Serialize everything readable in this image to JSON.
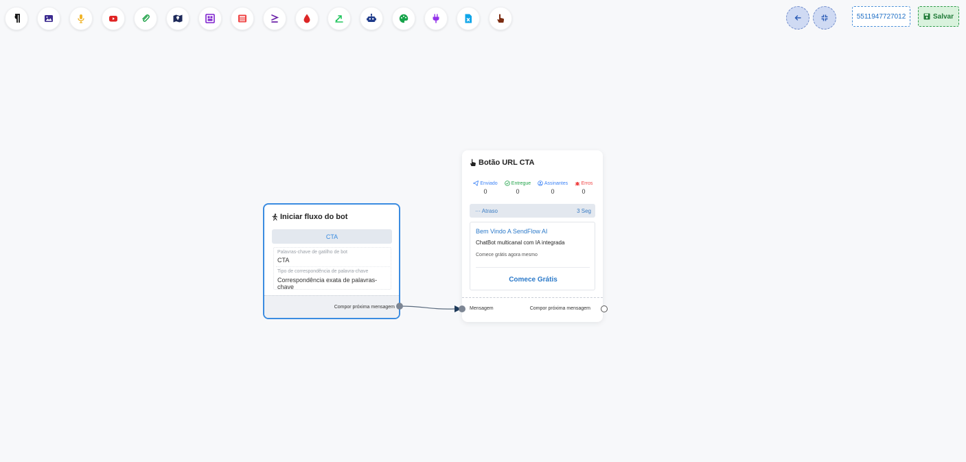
{
  "toolbar": {
    "tools": [
      {
        "name": "paragraph-icon",
        "color": "#111111"
      },
      {
        "name": "image-icon",
        "color": "#3b2a8f"
      },
      {
        "name": "microphone-icon",
        "color": "#f0b429"
      },
      {
        "name": "youtube-icon",
        "color": "#e02424"
      },
      {
        "name": "paperclip-icon",
        "color": "#22a34a"
      },
      {
        "name": "map-icon",
        "color": "#1e2a5a"
      },
      {
        "name": "poll-icon",
        "color": "#7e22ce"
      },
      {
        "name": "newspaper-icon",
        "color": "#ef4444"
      },
      {
        "name": "greater-equal-icon",
        "color": "#6b21a8"
      },
      {
        "name": "drop-icon",
        "color": "#dc2626"
      },
      {
        "name": "webhook-icon",
        "color": "#22c55e"
      },
      {
        "name": "robot-icon",
        "color": "#1e3a8a"
      },
      {
        "name": "palette-icon",
        "color": "#16a34a"
      },
      {
        "name": "plug-icon",
        "color": "#9333ea"
      },
      {
        "name": "excel-file-icon",
        "color": "#0ea5e9"
      },
      {
        "name": "hand-pointer-icon",
        "color": "#7c2d12"
      }
    ],
    "phone": "5511947727012",
    "save_label": "Salvar"
  },
  "start_node": {
    "title": "Iniciar fluxo do bot",
    "chip": "CTA",
    "keywords_label": "Palavras-chave de gatilho de bot",
    "keywords_value": "CTA",
    "match_type_label": "Tipo de correspondência de palavra-chave",
    "match_type_value": "Correspondência exata de palavras-chave",
    "footer_label": "Compor próxima mensagem"
  },
  "cta_node": {
    "title": "Botão URL CTA",
    "stats": [
      {
        "label": "Enviado",
        "value": "0",
        "color": "#3b82f6",
        "icon": "paper-plane-icon"
      },
      {
        "label": "Entregue",
        "value": "0",
        "color": "#22a34a",
        "icon": "check-circle-icon"
      },
      {
        "label": "Assinantes",
        "value": "0",
        "color": "#3b82f6",
        "icon": "user-circle-icon"
      },
      {
        "label": "Erros",
        "value": "0",
        "color": "#ef4444",
        "icon": "bug-icon"
      }
    ],
    "delay_label": "··· Atraso",
    "delay_value": "3 Seg",
    "card": {
      "title": "Bem Vindo A SendFlow AI",
      "body": "ChatBot multicanal com IA integrada",
      "footer": "Comece grátis agora mesmo",
      "button": "Comece Grátis"
    },
    "input_label": "Mensagem",
    "output_label": "Compor próxima mensagem"
  }
}
